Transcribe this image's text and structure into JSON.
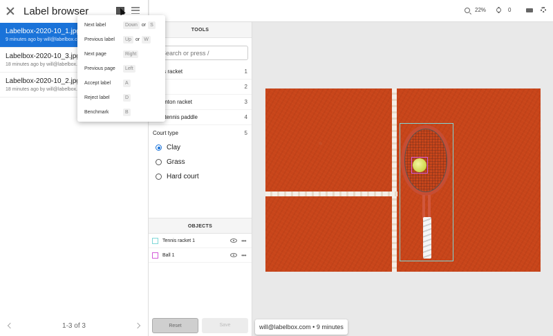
{
  "app": {
    "title": "Label browser"
  },
  "labels": [
    {
      "name": "Labelbox-2020-10_1.jpg",
      "meta": "9 minutes ago by will@labelbox.com",
      "active": true
    },
    {
      "name": "Labelbox-2020-10_3.jpg",
      "meta": "18 minutes ago by will@labelbox.com",
      "active": false
    },
    {
      "name": "Labelbox-2020-10_2.jpg",
      "meta": "18 minutes ago by will@labelbox.com",
      "active": false
    }
  ],
  "pager": {
    "text": "1-3 of 3"
  },
  "shortcuts": [
    {
      "action": "Next label",
      "keys": [
        "Down",
        "S"
      ]
    },
    {
      "action": "Previous label",
      "keys": [
        "Up",
        "W"
      ]
    },
    {
      "action": "Next page",
      "keys": [
        "Right"
      ]
    },
    {
      "action": "Previous page",
      "keys": [
        "Left"
      ]
    },
    {
      "action": "Accept label",
      "keys": [
        "A"
      ]
    },
    {
      "action": "Reject label",
      "keys": [
        "D"
      ]
    },
    {
      "action": "Benchmark",
      "keys": [
        "B"
      ]
    }
  ],
  "shortcut_or": "or",
  "tools_panel": {
    "heading": "TOOLS",
    "search_placeholder": "Search or press /",
    "tools": [
      {
        "name": "ennis racket",
        "num": "1"
      },
      {
        "name": "all",
        "num": "2"
      },
      {
        "name": "adminton racket",
        "num": "3"
      },
      {
        "name": "able tennis paddle",
        "num": "4"
      },
      {
        "name": "Court type",
        "num": "5"
      }
    ],
    "court_options": [
      {
        "label": "Clay",
        "selected": true
      },
      {
        "label": "Grass",
        "selected": false
      },
      {
        "label": "Hard court",
        "selected": false
      }
    ]
  },
  "objects_panel": {
    "heading": "OBJECTS",
    "objects": [
      {
        "name": "Tennis racket 1",
        "color": "#7fd7d7"
      },
      {
        "name": "Ball 1",
        "color": "#d25ad8"
      }
    ]
  },
  "actions": {
    "reset": "Reset",
    "save": "Save"
  },
  "toolbar": {
    "zoom": "22%",
    "brightness": "0"
  },
  "status": {
    "text": "will@labelbox.com • 9 minutes"
  },
  "colors": {
    "accent": "#1a73d9",
    "court": "#c8451a"
  },
  "icons": [
    "close-icon",
    "screen-icon",
    "menu-icon",
    "zoom-icon",
    "brightness-icon",
    "keyboard-icon",
    "settings-icon",
    "eye-icon",
    "more-icon",
    "chevron-left-icon",
    "chevron-right-icon"
  ]
}
